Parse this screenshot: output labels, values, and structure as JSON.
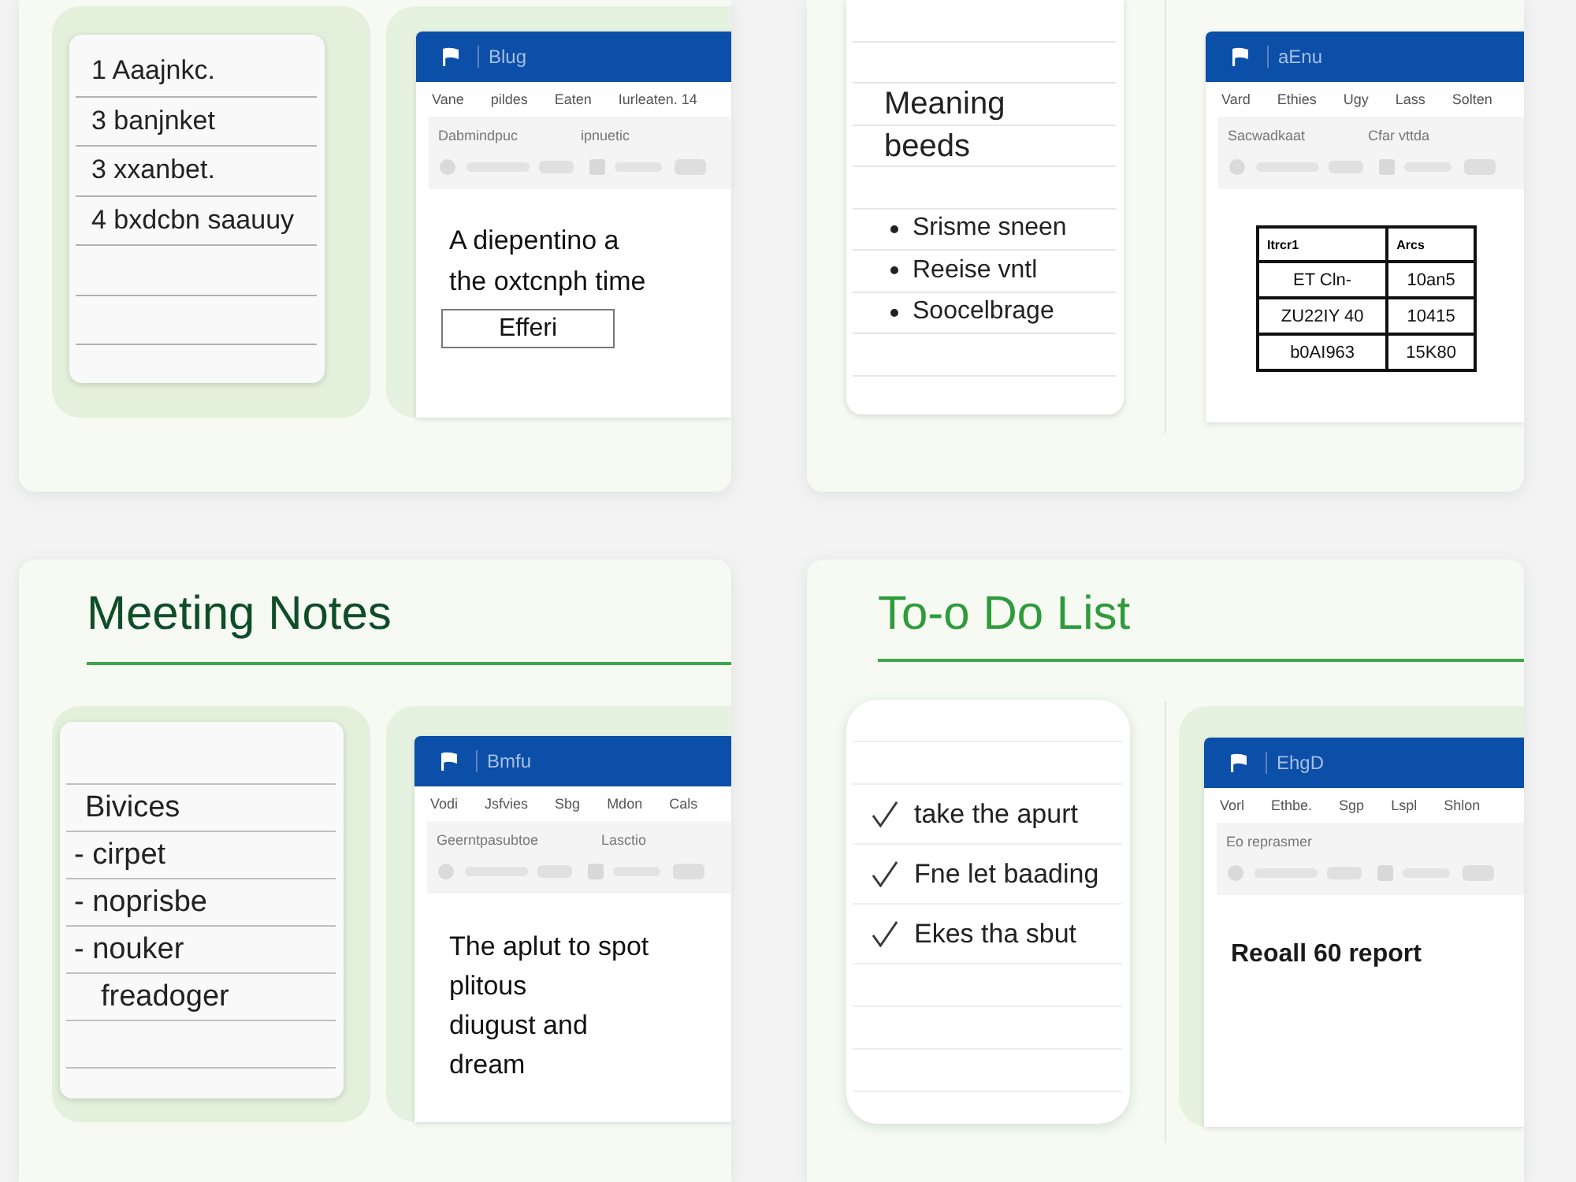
{
  "cards": [
    {
      "notes": {
        "framed": true,
        "lines": [
          {
            "kind": "text",
            "text": "1 Aaajnkc."
          },
          {
            "kind": "text",
            "text": "3 banjnket"
          },
          {
            "kind": "text",
            "text": "3 xxanbet."
          },
          {
            "kind": "text",
            "text": "4 bxdcbn saauuy"
          }
        ]
      },
      "divider": false,
      "window": {
        "framed": true,
        "title": "Blug",
        "menu": [
          "Vane",
          "pildes",
          "Eaten",
          "Iurleaten. 14"
        ],
        "ribbon_labels": [
          "Dabmindpuc",
          "ipnuetic"
        ],
        "body": [
          {
            "kind": "paragraph",
            "text": "A diepentino a\nthe oxtcnph time"
          },
          {
            "kind": "boxed",
            "text": "Efferi"
          }
        ]
      }
    },
    {
      "notes": {
        "framed": false,
        "lines": [
          {
            "kind": "blank"
          },
          {
            "kind": "blank"
          },
          {
            "kind": "heading",
            "text": "Meaning\nbeeds"
          },
          {
            "kind": "blank"
          },
          {
            "kind": "bullet",
            "text": "Srisme sneen"
          },
          {
            "kind": "bullet",
            "text": "Reeise vntl"
          },
          {
            "kind": "bullet",
            "text": "Soocelbrage"
          }
        ]
      },
      "divider": true,
      "window": {
        "framed": false,
        "title": "aEnu",
        "menu": [
          "Vard",
          "Ethies",
          "Ugy",
          "Lass",
          "Solten"
        ],
        "ribbon_labels": [
          "Sacwadkaat",
          "Cfar vttda"
        ],
        "body": [
          {
            "kind": "table",
            "columns": [
              "Itrcr1",
              "Arcs"
            ],
            "rows": [
              [
                "ET Cln-",
                "10an5"
              ],
              [
                "ZU22IY 40",
                "10415"
              ],
              [
                "b0AI963",
                "15K80"
              ]
            ]
          }
        ]
      }
    },
    {
      "title": "Meeting Notes",
      "notes": {
        "framed": true,
        "lines": [
          {
            "kind": "blank"
          },
          {
            "kind": "text",
            "text": "Bivices"
          },
          {
            "kind": "dash",
            "text": "- cirpet"
          },
          {
            "kind": "dash",
            "text": "- noprisbe"
          },
          {
            "kind": "dash",
            "text": "- nouker"
          },
          {
            "kind": "indent",
            "text": "freadoger"
          }
        ]
      },
      "divider": false,
      "window": {
        "framed": true,
        "title": "Bmfu",
        "menu": [
          "Vodi",
          "Jsfvies",
          "Sbg",
          "Mdon",
          "Cals"
        ],
        "ribbon_labels": [
          "Geerntpasubtoe",
          "Lasctio"
        ],
        "body": [
          {
            "kind": "paragraph",
            "text": "The aplut to spot\nplitous\ndiugust and\ndream"
          }
        ]
      }
    },
    {
      "title": "To-o Do List",
      "notes": {
        "framed": false,
        "lines": [
          {
            "kind": "blank"
          },
          {
            "kind": "blank"
          },
          {
            "kind": "check",
            "text": "take the apurt",
            "checked": true
          },
          {
            "kind": "check",
            "text": "Fne let baading",
            "checked": true
          },
          {
            "kind": "check",
            "text": "Ekes tha sbut",
            "checked": true
          }
        ]
      },
      "divider": true,
      "window": {
        "framed": true,
        "title": "EhgD",
        "menu": [
          "Vorl",
          "Ethbe.",
          "Sgp",
          "Lspl",
          "Shlon"
        ],
        "ribbon_labels": [
          "Eo reprasmer"
        ],
        "body": [
          {
            "kind": "label",
            "text": "Reoall 60 report"
          }
        ]
      }
    }
  ]
}
